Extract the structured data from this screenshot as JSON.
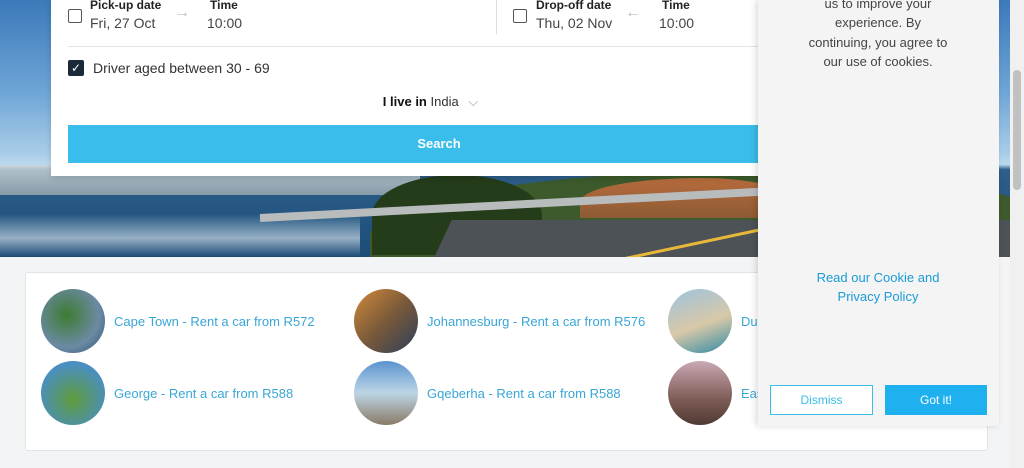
{
  "search_form": {
    "pickup_date_label": "Pick-up date",
    "pickup_date_value": "Fri, 27 Oct",
    "pickup_time_label": "Time",
    "pickup_time_value": "10:00",
    "dropoff_date_label": "Drop-off date",
    "dropoff_date_value": "Thu, 02 Nov",
    "dropoff_time_label": "Time",
    "dropoff_time_value": "10:00",
    "driver_age_label": "Driver aged between 30 - 69",
    "driver_age_checked": true,
    "residence_prefix": "I live in",
    "residence_value": "India",
    "search_button": "Search"
  },
  "destinations": [
    {
      "label": "Cape Town - Rent a car from R572"
    },
    {
      "label": "Johannesburg - Rent a car from R576"
    },
    {
      "label": "Dur"
    },
    {
      "label": "George - Rent a car from R588"
    },
    {
      "label": "Gqeberha - Rent a car from R588"
    },
    {
      "label": "Eas"
    }
  ],
  "cookie_banner": {
    "text": "us to improve your experience. By continuing, you agree to our use of cookies.",
    "policy_link": "Read our Cookie and Privacy Policy",
    "dismiss_button": "Dismiss",
    "accept_button": "Got it!"
  },
  "colors": {
    "accent": "#3abdea",
    "link": "#3aa6d6",
    "checkbox": "#1a2a3a"
  }
}
